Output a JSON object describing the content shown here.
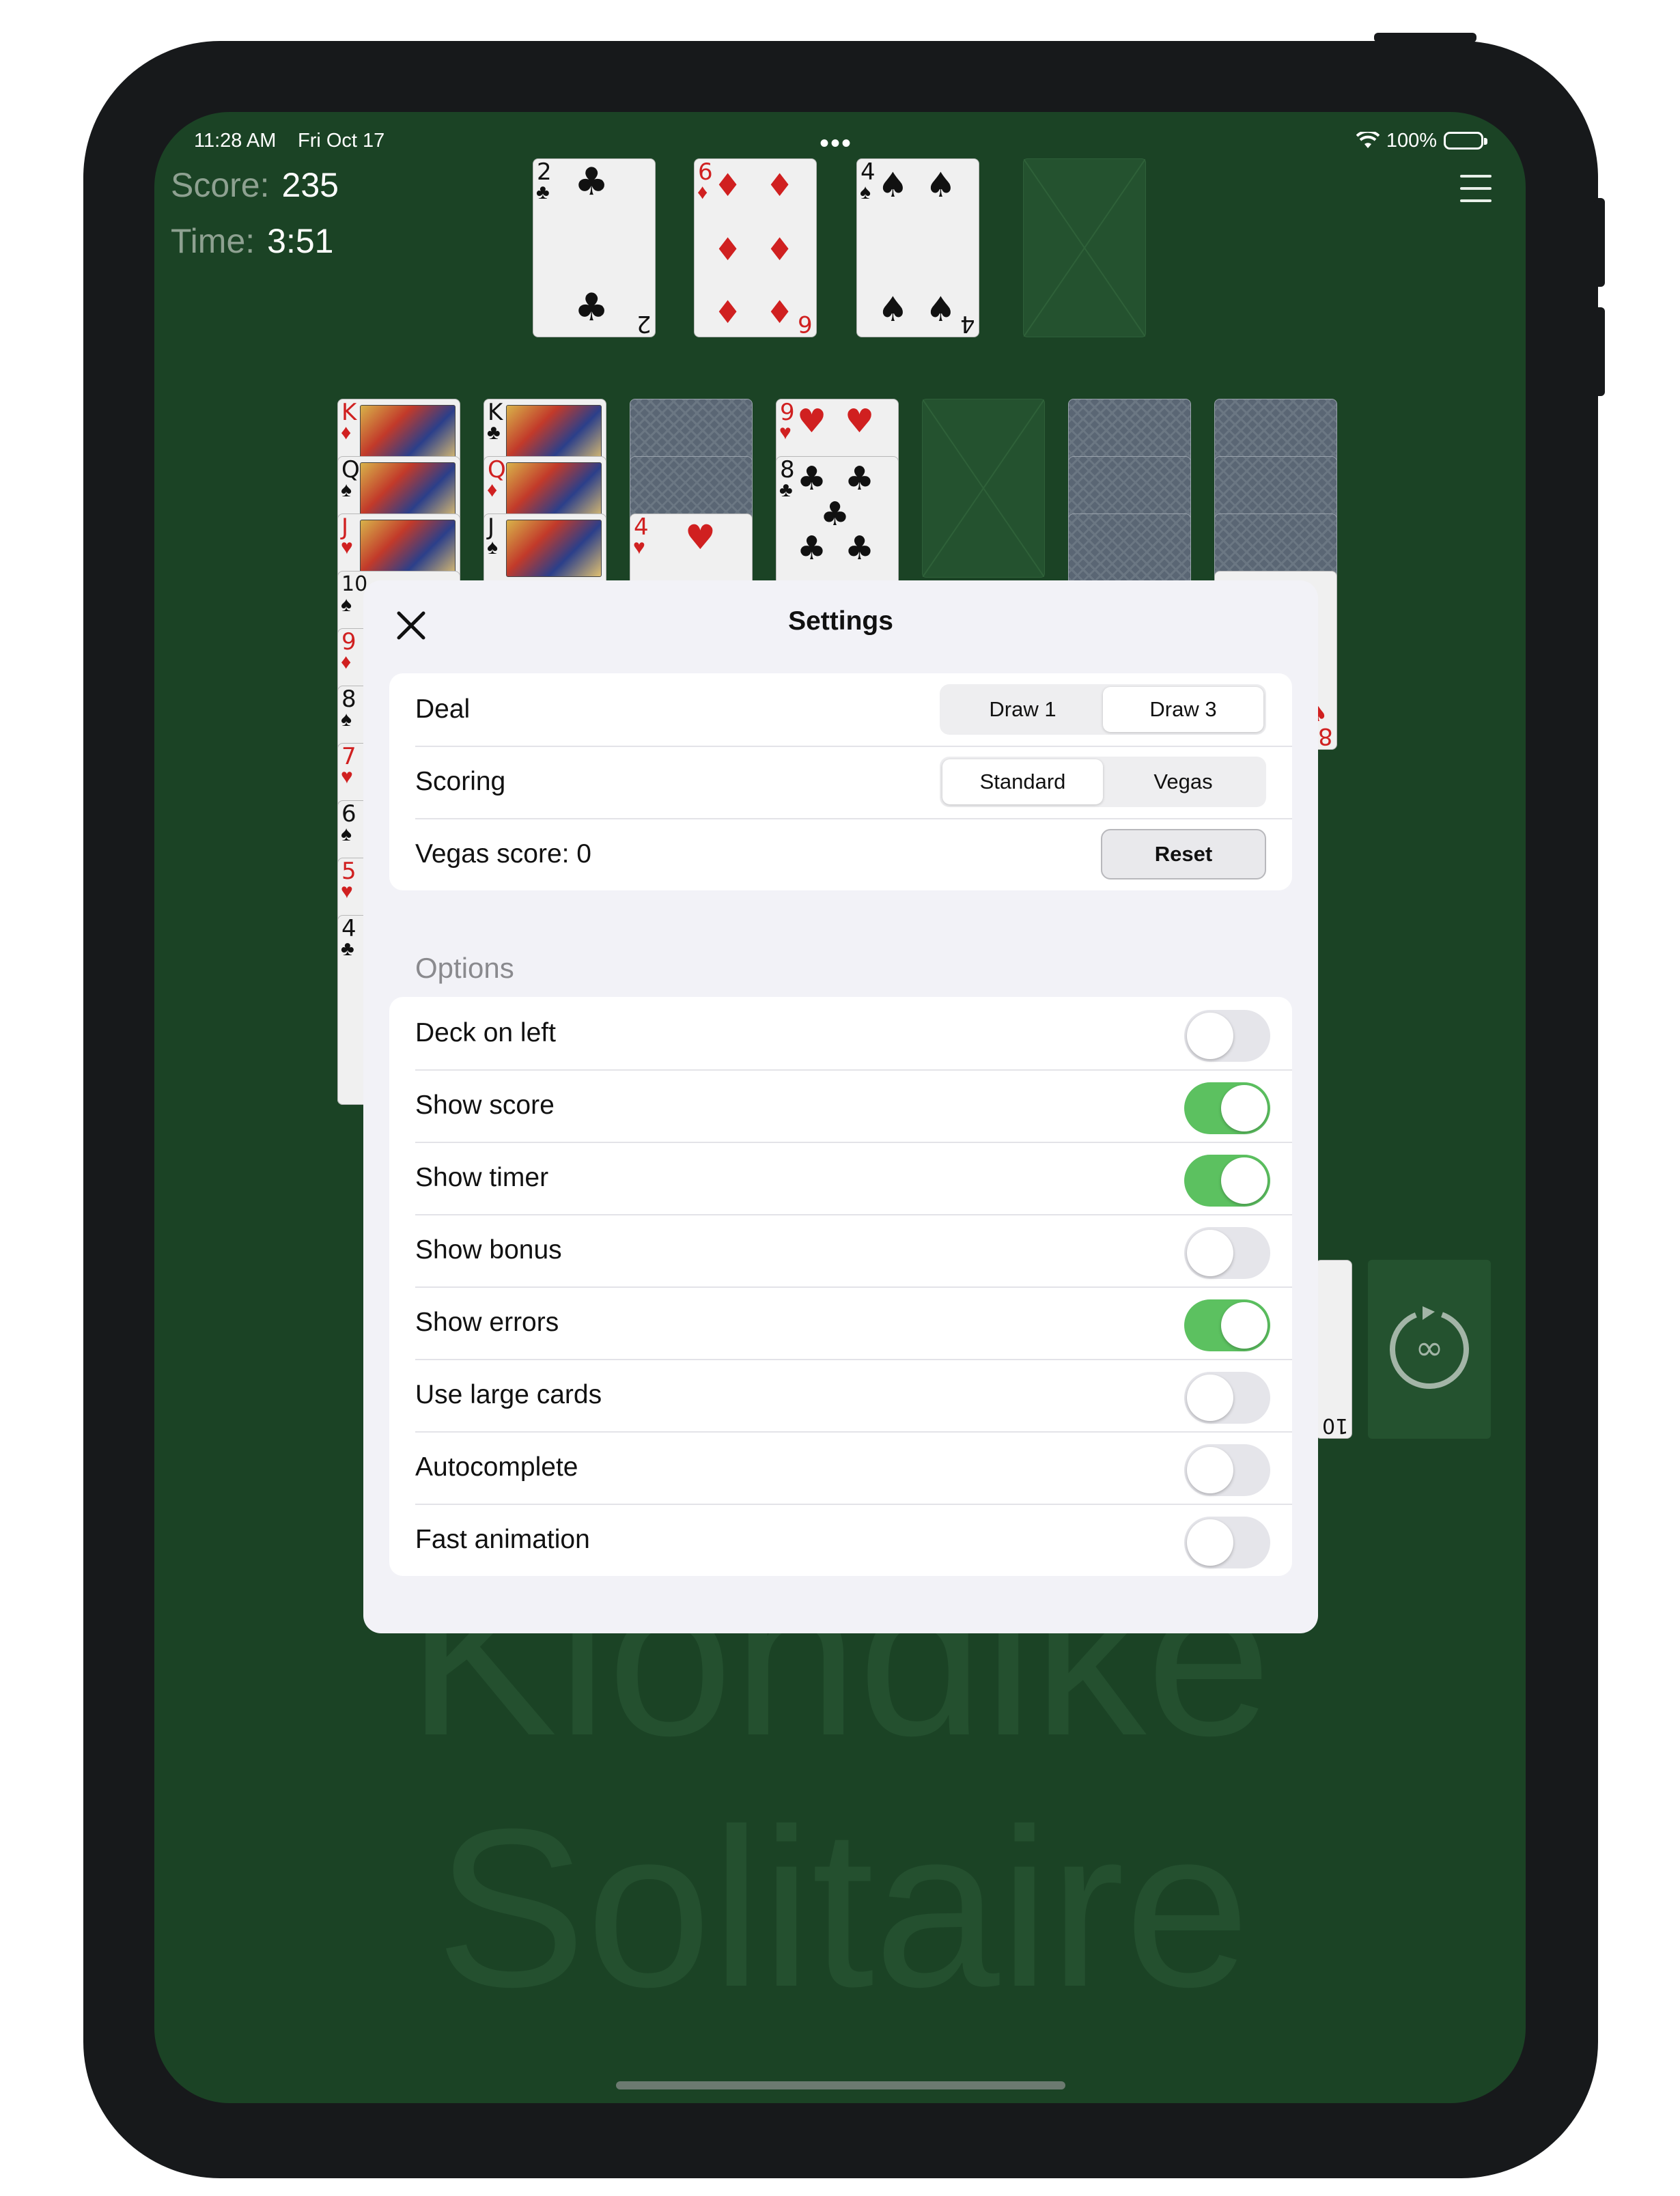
{
  "status_bar": {
    "time": "11:28 AM",
    "date": "Fri Oct 17",
    "dots": "•••",
    "battery": "100%"
  },
  "game": {
    "score_label": "Score:",
    "score": "235",
    "time_label": "Time:",
    "time": "3:51",
    "watermark_line1": "Klondike",
    "watermark_line2": "Solitaire"
  },
  "waste_cards": [
    {
      "rank": "2",
      "suit": "♣",
      "color": "black"
    },
    {
      "rank": "6",
      "suit": "♦",
      "color": "red"
    },
    {
      "rank": "4",
      "suit": "♠",
      "color": "black"
    }
  ],
  "tableau": {
    "col1": [
      "K",
      "Q",
      "J",
      "10",
      "9",
      "8",
      "7",
      "6",
      "5",
      "4"
    ],
    "col1_suits": [
      "♦",
      "♠",
      "♥",
      "♠",
      "♦",
      "♠",
      "♥",
      "♠",
      "♥",
      "♣"
    ],
    "col2": [
      "K",
      "Q",
      "J"
    ],
    "col2_suits": [
      "♣",
      "♦",
      "♠"
    ],
    "col3_top": {
      "rank": "4",
      "suit": "♥"
    },
    "col4_top": {
      "rank": "9",
      "suit": "♥"
    },
    "col4_second": {
      "rank": "8",
      "suit": "♣"
    },
    "col7_bottom": {
      "rank": "8",
      "suit": "♠"
    },
    "stock_edge": {
      "rank": "10",
      "suit": "♣"
    }
  },
  "settings": {
    "title": "Settings",
    "deal": {
      "label": "Deal",
      "options": [
        "Draw 1",
        "Draw 3"
      ],
      "selected": 1
    },
    "scoring": {
      "label": "Scoring",
      "options": [
        "Standard",
        "Vegas"
      ],
      "selected": 0
    },
    "vegas": {
      "label": "Vegas score: 0",
      "reset_label": "Reset"
    },
    "options_header": "Options",
    "options": [
      {
        "label": "Deck on left",
        "on": false
      },
      {
        "label": "Show score",
        "on": true
      },
      {
        "label": "Show timer",
        "on": true
      },
      {
        "label": "Show bonus",
        "on": false
      },
      {
        "label": "Show errors",
        "on": true
      },
      {
        "label": "Use large cards",
        "on": false
      },
      {
        "label": "Autocomplete",
        "on": false
      },
      {
        "label": "Fast animation",
        "on": false
      }
    ]
  },
  "colors": {
    "table_green": "#1b4325",
    "toggle_on": "#5cc160",
    "toggle_off": "#e5e5ea"
  }
}
